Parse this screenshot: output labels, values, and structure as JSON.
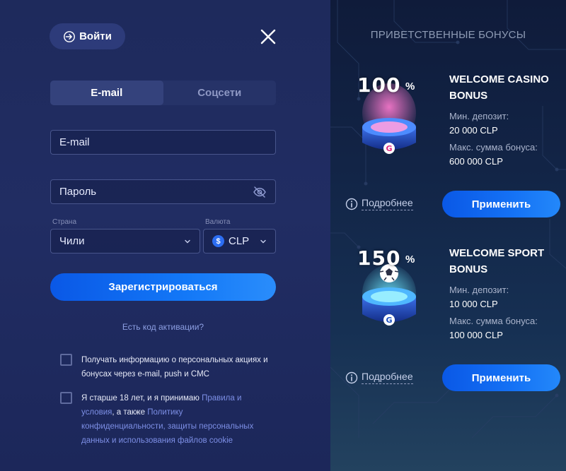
{
  "header": {
    "login_label": "Войти",
    "close_icon": "close-icon",
    "login_icon": "login-arrow-icon"
  },
  "tabs": [
    {
      "label": "E-mail",
      "active": true
    },
    {
      "label": "Соцсети",
      "active": false
    }
  ],
  "form": {
    "email_placeholder": "E-mail",
    "password_placeholder": "Пароль",
    "country_label": "Страна",
    "country_value": "Чили",
    "currency_label": "Валюта",
    "currency_symbol": "$",
    "currency_value": "CLP",
    "register_label": "Зарегистрироваться",
    "activation_link": "Есть код активации?"
  },
  "checks": {
    "promo_text": "Получать информацию о персональных акциях и бонусах через e-mail, push и СМС",
    "age_text_1": "Я старше 18 лет, и я принимаю ",
    "age_link_terms": "Правила и условия",
    "age_text_2": ", а также ",
    "age_link_privacy": "Политику конфиденциальности, защиты персональных данных и использования файлов cookie"
  },
  "bonuses": {
    "title": "ПРИВЕТСТВЕННЫЕ БОНУСЫ",
    "items": [
      {
        "percent": "100",
        "percent_sign": "%",
        "title": "WELCOME CASINO BONUS",
        "min_label": "Мин. депозит:",
        "min_value": "20 000 CLP",
        "max_label": "Макс. сумма бонуса:",
        "max_value": "600 000 CLP",
        "more_label": "Подробнее",
        "apply_label": "Применить"
      },
      {
        "percent": "150",
        "percent_sign": "%",
        "title": "WELCOME SPORT BONUS",
        "min_label": "Мин. депозит:",
        "min_value": "10 000 CLP",
        "max_label": "Макс. сумма бонуса:",
        "max_value": "100 000 CLP",
        "more_label": "Подробнее",
        "apply_label": "Применить"
      }
    ]
  },
  "colors": {
    "accent": "#1572f5",
    "left_bg": "#212d63",
    "right_bg": "#122446",
    "link": "#7d8fe6"
  }
}
